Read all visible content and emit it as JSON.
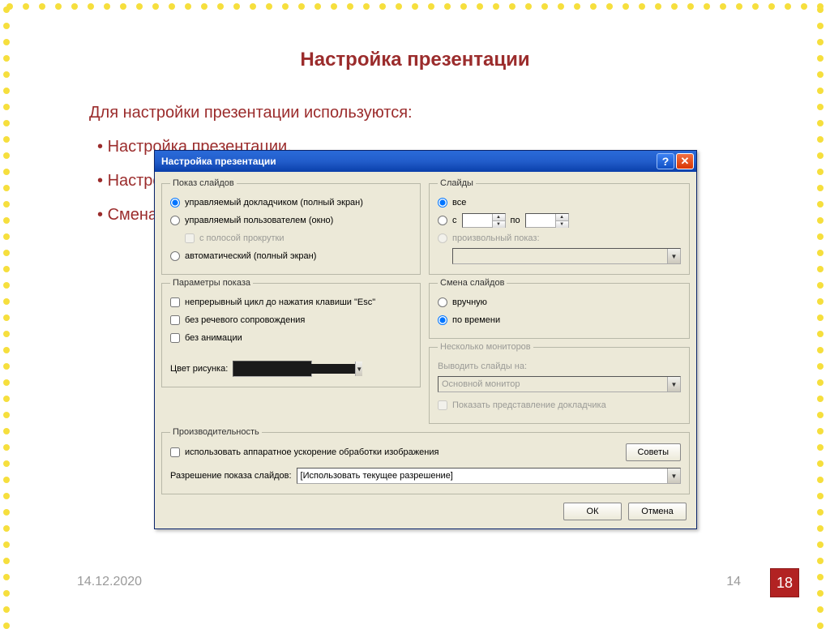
{
  "slide": {
    "title": "Настройка презентации",
    "intro": "Для настройки презентации используются:",
    "bullets": [
      "Настройка презентации,",
      "Настройка времени,",
      "Смена слайдов"
    ],
    "date": "14.12.2020",
    "page_small": "14",
    "page_big": "18"
  },
  "dialog": {
    "title": "Настройка презентации",
    "show_type": {
      "legend": "Показ слайдов",
      "opt1": "управляемый докладчиком (полный экран)",
      "opt2": "управляемый пользователем (окно)",
      "scroll": "с полосой прокрутки",
      "opt3": "автоматический (полный экран)"
    },
    "show_params": {
      "legend": "Параметры показа",
      "chk1": "непрерывный цикл до нажатия клавиши \"Esc\"",
      "chk2": "без речевого сопровождения",
      "chk3": "без анимации",
      "color_label": "Цвет рисунка:"
    },
    "slides": {
      "legend": "Слайды",
      "all": "все",
      "from": "с",
      "to": "по",
      "custom": "произвольный показ:"
    },
    "advance": {
      "legend": "Смена слайдов",
      "manual": "вручную",
      "timing": "по времени"
    },
    "monitors": {
      "legend": "Несколько мониторов",
      "output_label": "Выводить слайды на:",
      "output_value": "Основной монитор",
      "presenter": "Показать представление докладчика"
    },
    "perf": {
      "legend": "Производительность",
      "hwaccel": "использовать аппаратное ускорение обработки изображения",
      "tips": "Советы",
      "res_label": "Разрешение показа слайдов:",
      "res_value": "[Использовать текущее разрешение]"
    },
    "buttons": {
      "ok": "ОК",
      "cancel": "Отмена"
    }
  }
}
